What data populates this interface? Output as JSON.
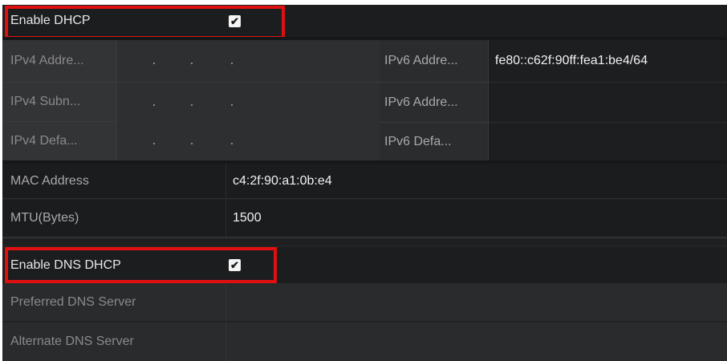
{
  "dhcp": {
    "label": "Enable DHCP",
    "checked": true
  },
  "ipv4": {
    "address_label": "IPv4 Addre...",
    "subnet_label": "IPv4 Subn...",
    "gateway_label": "IPv4 Defa..."
  },
  "ipv6": {
    "address1_label": "IPv6 Addre...",
    "address1_value": "fe80::c62f:90ff:fea1:be4/64",
    "address2_label": "IPv6 Addre...",
    "gateway_label": "IPv6 Defa..."
  },
  "mac": {
    "label": "MAC Address",
    "value": "c4:2f:90:a1:0b:e4"
  },
  "mtu": {
    "label": "MTU(Bytes)",
    "value": "1500"
  },
  "dns_dhcp": {
    "label": "Enable DNS DHCP",
    "checked": true
  },
  "preferred_dns": {
    "label": "Preferred DNS Server",
    "value": ""
  },
  "alternate_dns": {
    "label": "Alternate DNS Server",
    "value": ""
  },
  "colors": {
    "highlight": "#e01010",
    "background": "#222324"
  }
}
